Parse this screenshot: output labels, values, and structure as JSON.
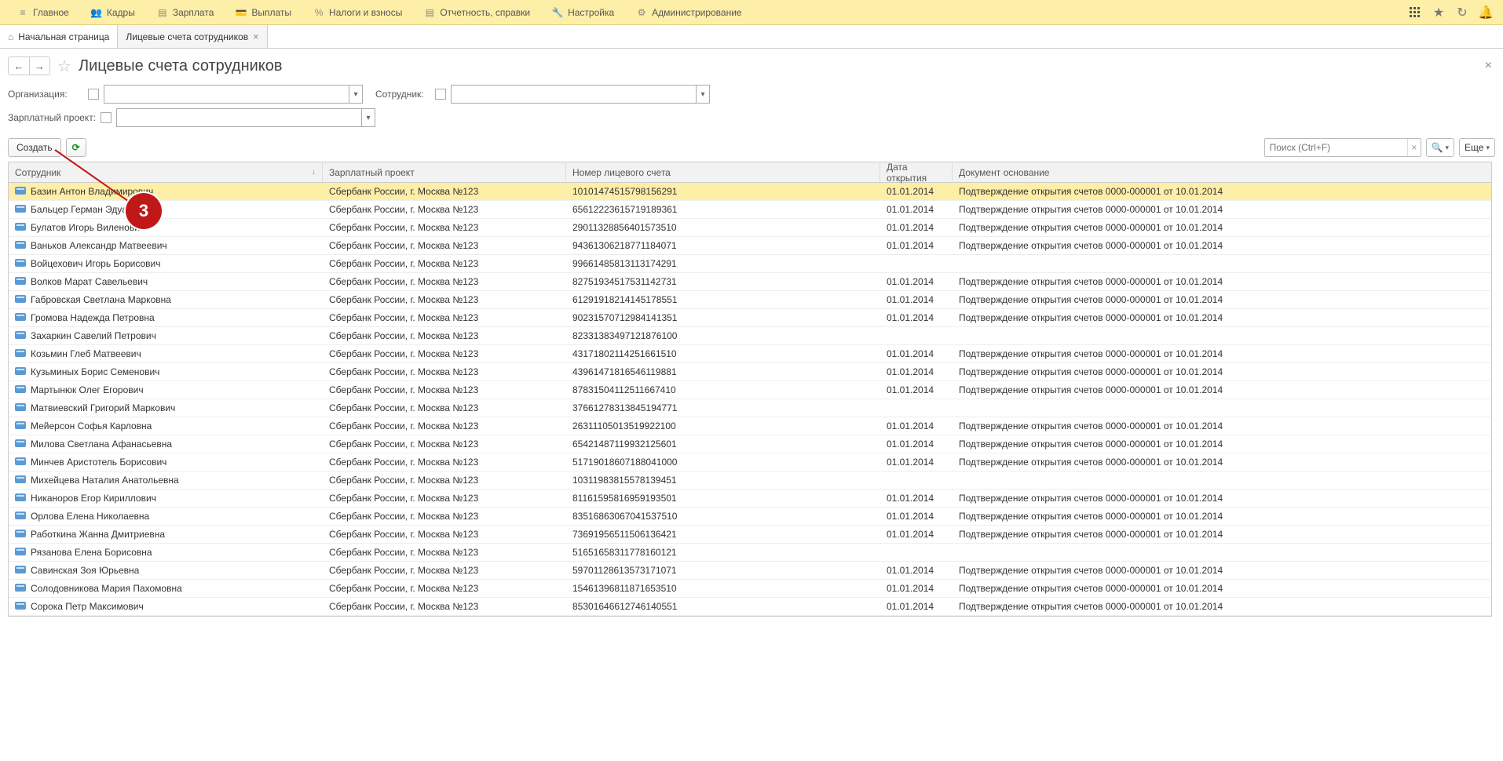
{
  "topbar": {
    "items": [
      {
        "label": "Главное"
      },
      {
        "label": "Кадры"
      },
      {
        "label": "Зарплата"
      },
      {
        "label": "Выплаты"
      },
      {
        "label": "Налоги и взносы"
      },
      {
        "label": "Отчетность, справки"
      },
      {
        "label": "Настройка"
      },
      {
        "label": "Администрирование"
      }
    ]
  },
  "tabs": {
    "home": "Начальная страница",
    "active": "Лицевые счета сотрудников"
  },
  "page": {
    "title": "Лицевые счета сотрудников"
  },
  "filters": {
    "org_label": "Организация:",
    "emp_label": "Сотрудник:",
    "proj_label": "Зарплатный проект:"
  },
  "toolbar": {
    "create_label": "Создать",
    "search_placeholder": "Поиск (Ctrl+F)",
    "more_label": "Еще"
  },
  "grid": {
    "headers": {
      "employee": "Сотрудник",
      "project": "Зарплатный проект",
      "account": "Номер лицевого счета",
      "date": "Дата открытия",
      "doc": "Документ основание"
    },
    "rows": [
      {
        "employee": "Базин Антон Владимирович",
        "project": "Сбербанк России, г. Москва №123",
        "account": "10101474515798156291",
        "date": "01.01.2014",
        "doc": "Подтверждение открытия счетов 0000-000001 от 10.01.2014"
      },
      {
        "employee": "Бальцер Герман Эдуардович",
        "project": "Сбербанк России, г. Москва №123",
        "account": "65612223615719189361",
        "date": "01.01.2014",
        "doc": "Подтверждение открытия счетов 0000-000001 от 10.01.2014"
      },
      {
        "employee": "Булатов Игорь Виленович",
        "project": "Сбербанк России, г. Москва №123",
        "account": "29011328856401573510",
        "date": "01.01.2014",
        "doc": "Подтверждение открытия счетов 0000-000001 от 10.01.2014"
      },
      {
        "employee": "Ваньков Александр Матвеевич",
        "project": "Сбербанк России, г. Москва №123",
        "account": "94361306218771184071",
        "date": "01.01.2014",
        "doc": "Подтверждение открытия счетов 0000-000001 от 10.01.2014"
      },
      {
        "employee": "Войцехович Игорь Борисович",
        "project": "Сбербанк России, г. Москва №123",
        "account": "99661485813113174291",
        "date": "",
        "doc": ""
      },
      {
        "employee": "Волков Марат Савельевич",
        "project": "Сбербанк России, г. Москва №123",
        "account": "82751934517531142731",
        "date": "01.01.2014",
        "doc": "Подтверждение открытия счетов 0000-000001 от 10.01.2014"
      },
      {
        "employee": "Габровская Светлана Марковна",
        "project": "Сбербанк России, г. Москва №123",
        "account": "61291918214145178551",
        "date": "01.01.2014",
        "doc": "Подтверждение открытия счетов 0000-000001 от 10.01.2014"
      },
      {
        "employee": "Громова Надежда Петровна",
        "project": "Сбербанк России, г. Москва №123",
        "account": "90231570712984141351",
        "date": "01.01.2014",
        "doc": "Подтверждение открытия счетов 0000-000001 от 10.01.2014"
      },
      {
        "employee": "Захаркин Савелий Петрович",
        "project": "Сбербанк России, г. Москва №123",
        "account": "82331383497121876100",
        "date": "",
        "doc": ""
      },
      {
        "employee": "Козьмин Глеб Матвеевич",
        "project": "Сбербанк России, г. Москва №123",
        "account": "43171802114251661510",
        "date": "01.01.2014",
        "doc": "Подтверждение открытия счетов 0000-000001 от 10.01.2014"
      },
      {
        "employee": "Кузьминых Борис Семенович",
        "project": "Сбербанк России, г. Москва №123",
        "account": "43961471816546119881",
        "date": "01.01.2014",
        "doc": "Подтверждение открытия счетов 0000-000001 от 10.01.2014"
      },
      {
        "employee": "Мартынюк Олег Егорович",
        "project": "Сбербанк России, г. Москва №123",
        "account": "87831504112511667410",
        "date": "01.01.2014",
        "doc": "Подтверждение открытия счетов 0000-000001 от 10.01.2014"
      },
      {
        "employee": "Матвиевский Григорий Маркович",
        "project": "Сбербанк России, г. Москва №123",
        "account": "37661278313845194771",
        "date": "",
        "doc": ""
      },
      {
        "employee": "Мейерсон Софья Карловна",
        "project": "Сбербанк России, г. Москва №123",
        "account": "26311105013519922100",
        "date": "01.01.2014",
        "doc": "Подтверждение открытия счетов 0000-000001 от 10.01.2014"
      },
      {
        "employee": "Милова Светлана Афанасьевна",
        "project": "Сбербанк России, г. Москва №123",
        "account": "65421487119932125601",
        "date": "01.01.2014",
        "doc": "Подтверждение открытия счетов 0000-000001 от 10.01.2014"
      },
      {
        "employee": "Минчев Аристотель Борисович",
        "project": "Сбербанк России, г. Москва №123",
        "account": "51719018607188041000",
        "date": "01.01.2014",
        "doc": "Подтверждение открытия счетов 0000-000001 от 10.01.2014"
      },
      {
        "employee": "Михейцева Наталия Анатольевна",
        "project": "Сбербанк России, г. Москва №123",
        "account": "10311983815578139451",
        "date": "",
        "doc": ""
      },
      {
        "employee": "Никаноров Егор Кириллович",
        "project": "Сбербанк России, г. Москва №123",
        "account": "81161595816959193501",
        "date": "01.01.2014",
        "doc": "Подтверждение открытия счетов 0000-000001 от 10.01.2014"
      },
      {
        "employee": "Орлова Елена Николаевна",
        "project": "Сбербанк России, г. Москва №123",
        "account": "83516863067041537510",
        "date": "01.01.2014",
        "doc": "Подтверждение открытия счетов 0000-000001 от 10.01.2014"
      },
      {
        "employee": "Работкина Жанна Дмитриевна",
        "project": "Сбербанк России, г. Москва №123",
        "account": "73691956511506136421",
        "date": "01.01.2014",
        "doc": "Подтверждение открытия счетов 0000-000001 от 10.01.2014"
      },
      {
        "employee": "Рязанова Елена Борисовна",
        "project": "Сбербанк России, г. Москва №123",
        "account": "51651658311778160121",
        "date": "",
        "doc": ""
      },
      {
        "employee": "Савинская Зоя Юрьевна",
        "project": "Сбербанк России, г. Москва №123",
        "account": "59701128613573171071",
        "date": "01.01.2014",
        "doc": "Подтверждение открытия счетов 0000-000001 от 10.01.2014"
      },
      {
        "employee": "Солодовникова Мария Пахомовна",
        "project": "Сбербанк России, г. Москва №123",
        "account": "15461396811871653510",
        "date": "01.01.2014",
        "doc": "Подтверждение открытия счетов 0000-000001 от 10.01.2014"
      },
      {
        "employee": "Сорока Петр Максимович",
        "project": "Сбербанк России, г. Москва №123",
        "account": "85301646612746140551",
        "date": "01.01.2014",
        "doc": "Подтверждение открытия счетов 0000-000001 от 10.01.2014"
      }
    ]
  },
  "annotation": {
    "number": "3"
  }
}
